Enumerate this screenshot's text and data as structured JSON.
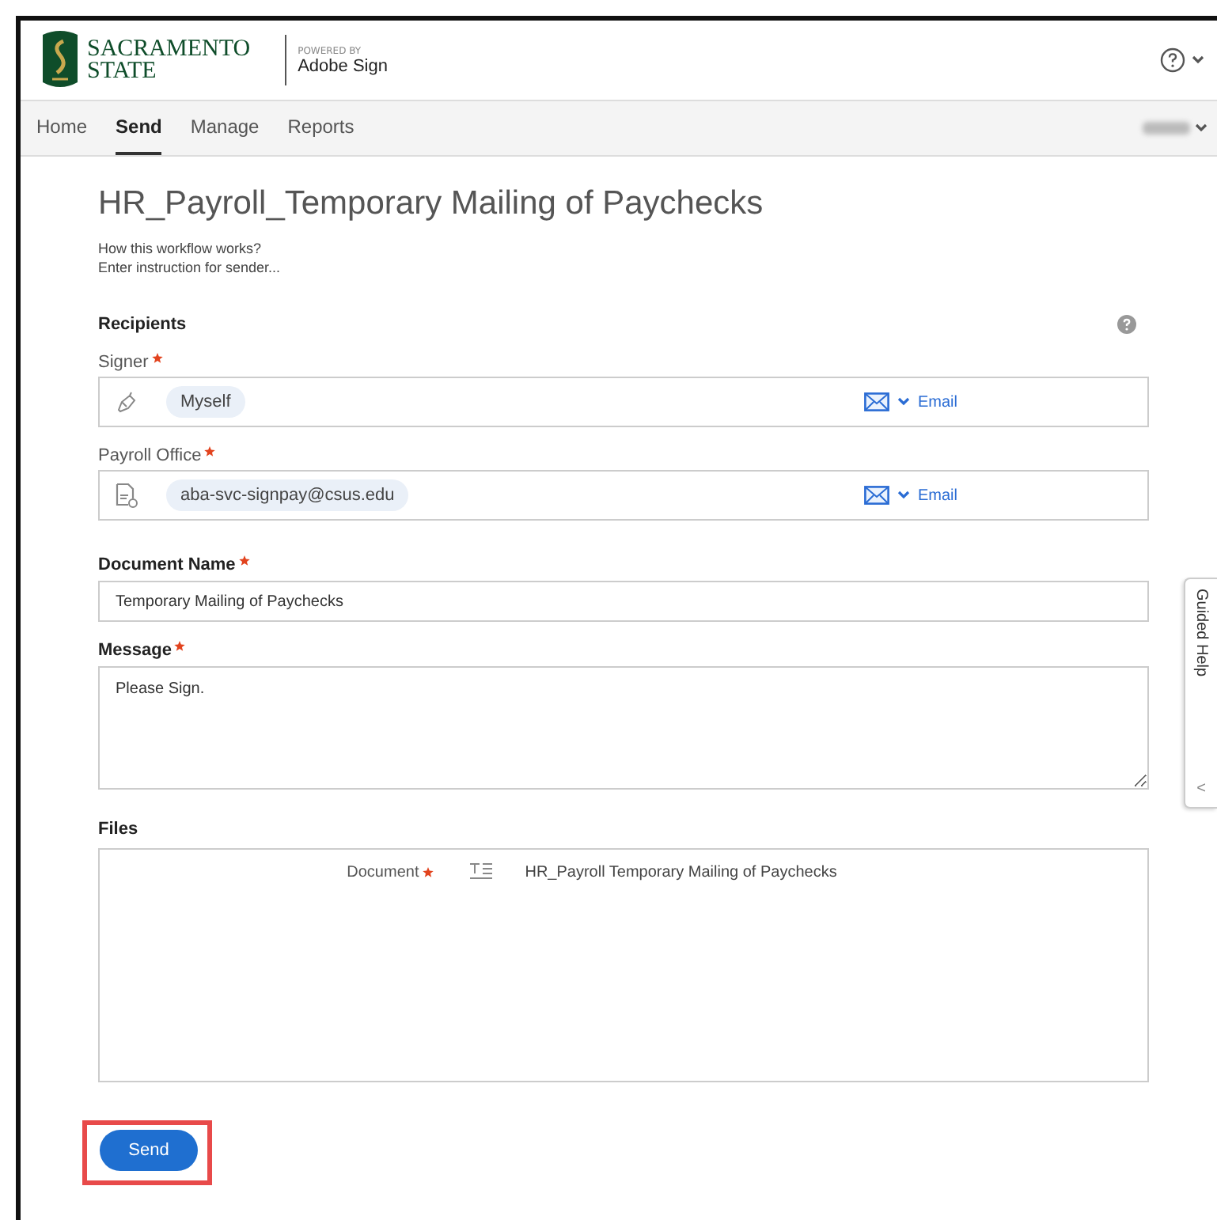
{
  "header": {
    "logo_line1": "SACRAMENTO",
    "logo_line2": "STATE",
    "powered_by": "POWERED BY",
    "product": "Adobe Sign"
  },
  "nav": {
    "tabs": [
      {
        "label": "Home",
        "selected": false
      },
      {
        "label": "Send",
        "selected": true
      },
      {
        "label": "Manage",
        "selected": false
      },
      {
        "label": "Reports",
        "selected": false
      }
    ]
  },
  "workflow": {
    "title": "HR_Payroll_Temporary Mailing of Paychecks",
    "how_it_works": "How this workflow works?",
    "instruction": "Enter instruction for sender..."
  },
  "recipients": {
    "heading": "Recipients",
    "items": [
      {
        "label": "Signer",
        "required": true,
        "kind": "signer",
        "value": "Myself",
        "delivery": "Email"
      },
      {
        "label": "Payroll Office",
        "required": true,
        "kind": "document",
        "value": "aba-svc-signpay@csus.edu",
        "delivery": "Email"
      }
    ]
  },
  "document_name": {
    "label": "Document Name",
    "required": true,
    "value": "Temporary Mailing of Paychecks"
  },
  "message": {
    "label": "Message",
    "required": true,
    "value": "Please Sign."
  },
  "files": {
    "heading": "Files",
    "items": [
      {
        "label": "Document",
        "required": true,
        "name": "HR_Payroll Temporary Mailing of Paychecks"
      }
    ]
  },
  "guided_help": {
    "label": "Guided Help",
    "arrow": "<"
  },
  "send_button": {
    "label": "Send",
    "highlighted": true
  }
}
